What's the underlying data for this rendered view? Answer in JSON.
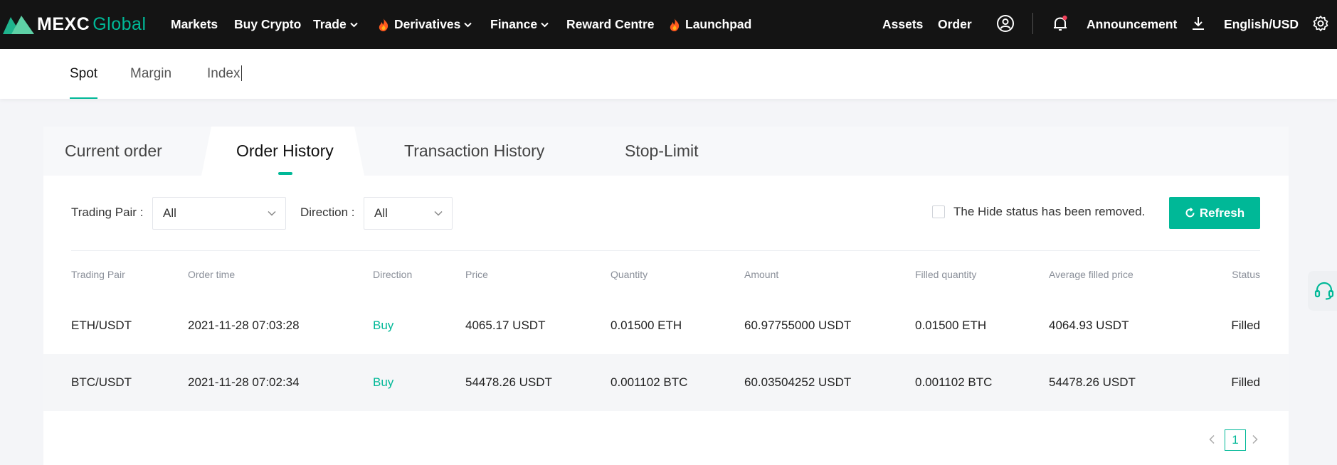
{
  "brand": {
    "name": "MEXC",
    "suffix": "Global",
    "accent": "#00b897"
  },
  "topnav": {
    "items": [
      {
        "label": "Markets"
      },
      {
        "label": "Buy Crypto"
      },
      {
        "label": "Trade"
      },
      {
        "label": "Derivatives"
      },
      {
        "label": "Finance"
      },
      {
        "label": "Reward Centre"
      },
      {
        "label": "Launchpad"
      }
    ],
    "right": {
      "assets": "Assets",
      "order": "Order",
      "announcement": "Announcement",
      "language": "English/USD"
    }
  },
  "subnav": {
    "tabs": [
      {
        "label": "Spot"
      },
      {
        "label": "Margin"
      },
      {
        "label": "Index"
      }
    ],
    "active": "Spot"
  },
  "orders": {
    "tabs": [
      {
        "label": "Current order"
      },
      {
        "label": "Order History"
      },
      {
        "label": "Transaction History"
      },
      {
        "label": "Stop-Limit"
      }
    ],
    "active_tab": "Order History",
    "filters": {
      "trading_pair_label": "Trading Pair :",
      "trading_pair_value": "All",
      "direction_label": "Direction :",
      "direction_value": "All",
      "hide_label": "The Hide status has been removed.",
      "hide_checked": false,
      "refresh_label": "Refresh"
    },
    "columns": [
      "Trading Pair",
      "Order time",
      "Direction",
      "Price",
      "Quantity",
      "Amount",
      "Filled quantity",
      "Average filled price",
      "Status"
    ],
    "rows": [
      {
        "pair": "ETH/USDT",
        "time": "2021-11-28 07:03:28",
        "direction": "Buy",
        "price": "4065.17 USDT",
        "quantity": "0.01500 ETH",
        "amount": "60.97755000 USDT",
        "filled": "0.01500 ETH",
        "avg_price": "4064.93 USDT",
        "status": "Filled"
      },
      {
        "pair": "BTC/USDT",
        "time": "2021-11-28 07:02:34",
        "direction": "Buy",
        "price": "54478.26 USDT",
        "quantity": "0.001102 BTC",
        "amount": "60.03504252 USDT",
        "filled": "0.001102 BTC",
        "avg_price": "54478.26 USDT",
        "status": "Filled"
      }
    ],
    "pagination": {
      "current_page": "1"
    }
  }
}
